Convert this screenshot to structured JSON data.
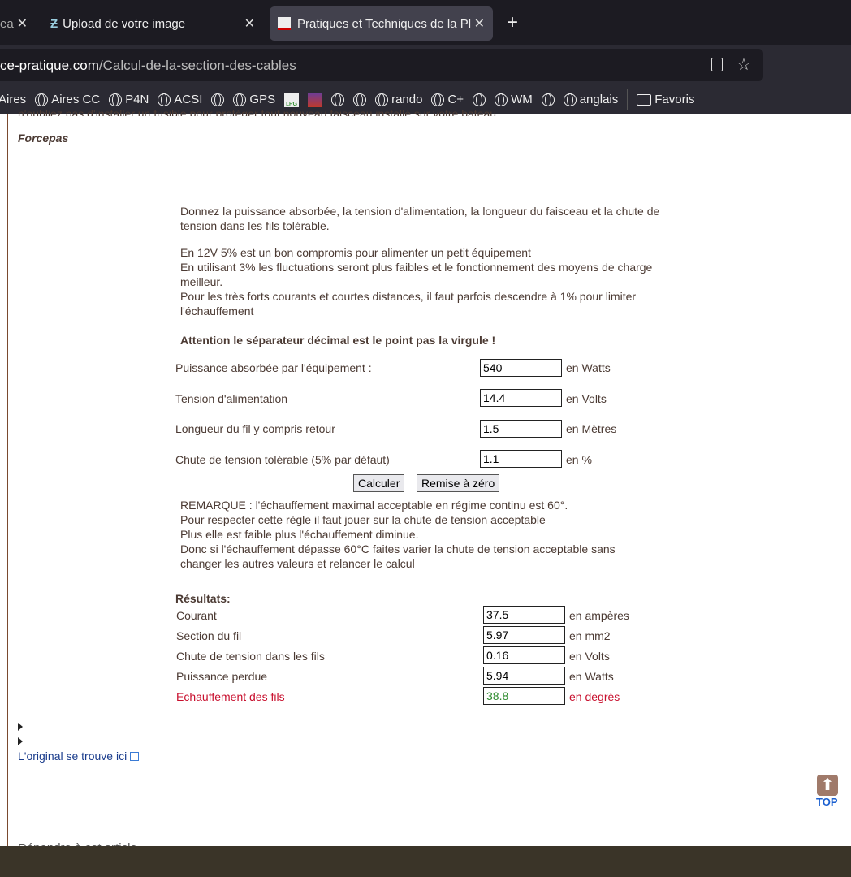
{
  "tabs": [
    {
      "label": "ea",
      "close": "✕"
    },
    {
      "label": "Upload de votre image",
      "close": "✕"
    },
    {
      "label": "Pratiques et Techniques de la Pl",
      "close": "✕",
      "active": true
    }
  ],
  "new_tab": "+",
  "url": {
    "domain": "ce-pratique.com",
    "path": "/Calcul-de-la-section-des-cables"
  },
  "bookmarks": [
    "Aires",
    "Aires CC",
    "P4N",
    "ACSI",
    "",
    "GPS",
    "LPG",
    "",
    "",
    "",
    "rando",
    "C+",
    "",
    "WM",
    "",
    "anglais"
  ],
  "bookmarks_folder": "Favoris",
  "page": {
    "top_cut": "n'oubliez pas d'installer un fusible pour protéger tout nouveau faisceau installé sur votre bateau.",
    "author": "Forcepas",
    "intro1": "Donnez la puissance absorbée, la tension d'alimentation, la longueur du faisceau et la chute de tension dans les fils tolérable.",
    "intro2": [
      "En 12V 5% est un bon compromis pour alimenter un petit équipement",
      "En utilisant 3% les fluctuations seront plus faibles et le fonctionnement des moyens de charge meilleur.",
      "Pour les très forts courants et courtes distances, il faut parfois descendre à 1% pour limiter l'échauffement"
    ],
    "warning": "Attention le séparateur décimal est le point pas la virgule !",
    "inputs": [
      {
        "label": "Puissance absorbée par l'équipement :",
        "value": "540",
        "unit": "en Watts"
      },
      {
        "label": "Tension d'alimentation",
        "value": "14.4",
        "unit": "en Volts"
      },
      {
        "label": "Longueur du fil y compris retour",
        "value": "1.5",
        "unit": "en Mètres"
      },
      {
        "label": "Chute de tension tolérable (5% par défaut)",
        "value": "1.1",
        "unit": "en %"
      }
    ],
    "calc_button": "Calculer",
    "reset_button": "Remise à zéro",
    "remarks": [
      "REMARQUE : l'échauffement maximal acceptable en régime continu est 60°.",
      "Pour respecter cette règle il faut jouer sur la chute de tension acceptable",
      "Plus elle est faible plus l'échauffement diminue.",
      "Donc si l'échauffement dépasse 60°C faites varier la chute de tension acceptable sans",
      "changer les autres valeurs et relancer le calcul"
    ],
    "results_title": "Résultats:",
    "results": [
      {
        "label": "Courant",
        "value": "37.5",
        "unit": "en ampères"
      },
      {
        "label": "Section du fil",
        "value": "5.97",
        "unit": "en mm2"
      },
      {
        "label": "Chute de tension dans les fils",
        "value": "0.16",
        "unit": "en Volts"
      },
      {
        "label": "Puissance perdue",
        "value": "5.94",
        "unit": "en Watts"
      },
      {
        "label": "Echauffement des fils",
        "value": "38.8",
        "unit": "en degrés"
      }
    ],
    "original_link": "L'original se trouve ici",
    "top_label": "TOP",
    "bottom_cut": "Répondre à cet article"
  },
  "colors": {
    "text": "#4b3a33",
    "link": "#1a3c8c",
    "heat": "#c8102e",
    "heat_value": "#2e8b2e"
  }
}
